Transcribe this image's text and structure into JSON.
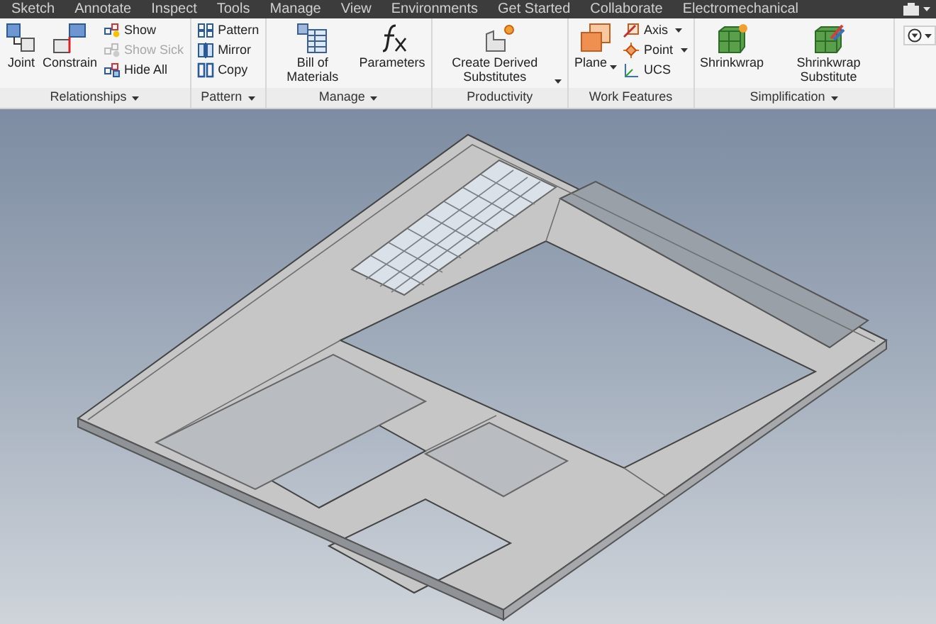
{
  "ribbon_tabs": [
    "Sketch",
    "Annotate",
    "Inspect",
    "Tools",
    "Manage",
    "View",
    "Environments",
    "Get Started",
    "Collaborate",
    "Electromechanical"
  ],
  "panels": [
    {
      "title": "Relationships",
      "has_menu": true,
      "tools": [
        {
          "kind": "large",
          "label": "Joint",
          "has_menu": false,
          "disabled": false
        },
        {
          "kind": "large",
          "label": "Constrain",
          "has_menu": false,
          "disabled": false
        },
        {
          "kind": "small",
          "label": "Show",
          "has_menu": false,
          "disabled": false
        },
        {
          "kind": "small",
          "label": "Show Sick",
          "has_menu": false,
          "disabled": true
        },
        {
          "kind": "small",
          "label": "Hide All",
          "has_menu": false,
          "disabled": false
        }
      ]
    },
    {
      "title": "Pattern",
      "has_menu": true,
      "tools": [
        {
          "kind": "small",
          "label": "Pattern",
          "has_menu": false,
          "disabled": false
        },
        {
          "kind": "small",
          "label": "Mirror",
          "has_menu": false,
          "disabled": false
        },
        {
          "kind": "small",
          "label": "Copy",
          "has_menu": false,
          "disabled": false
        }
      ]
    },
    {
      "title": "Manage",
      "has_menu": true,
      "tools": [
        {
          "kind": "large",
          "label": "Bill of Materials",
          "has_menu": false,
          "disabled": false
        },
        {
          "kind": "large",
          "label": "Parameters",
          "has_menu": false,
          "disabled": false
        }
      ]
    },
    {
      "title": "Productivity",
      "has_menu": false,
      "tools": [
        {
          "kind": "large",
          "label": "Create Derived Substitutes",
          "has_menu": true,
          "disabled": false
        }
      ]
    },
    {
      "title": "Work Features",
      "has_menu": false,
      "tools": [
        {
          "kind": "large",
          "label": "Plane",
          "has_menu": true,
          "disabled": false
        },
        {
          "kind": "small",
          "label": "Axis",
          "has_menu": true,
          "disabled": false
        },
        {
          "kind": "small",
          "label": "Point",
          "has_menu": true,
          "disabled": false
        },
        {
          "kind": "small",
          "label": "UCS",
          "has_menu": false,
          "disabled": false
        }
      ]
    },
    {
      "title": "Simplification",
      "has_menu": true,
      "tools": [
        {
          "kind": "large",
          "label": "Shrinkwrap",
          "has_menu": false,
          "disabled": false
        },
        {
          "kind": "large",
          "label": "Shrinkwrap Substitute",
          "has_menu": false,
          "disabled": false
        }
      ]
    }
  ]
}
